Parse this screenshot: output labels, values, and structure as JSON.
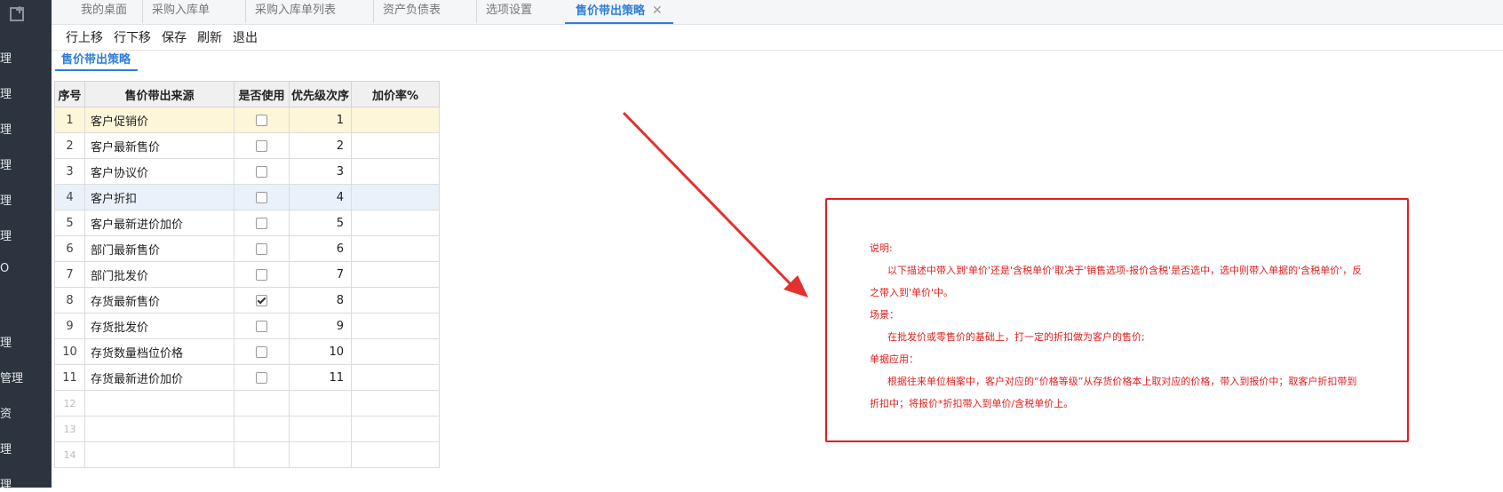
{
  "sidebar": {
    "items": [
      "理",
      "理",
      "理",
      "理",
      "理",
      "理",
      "O",
      "理",
      "管理",
      "资",
      "理",
      "理"
    ]
  },
  "tabs": [
    {
      "label": "我的桌面"
    },
    {
      "label": "采购入库单"
    },
    {
      "label": "采购入库单列表"
    },
    {
      "label": "资产负债表"
    },
    {
      "label": "选项设置"
    },
    {
      "label": "售价带出策略",
      "active": true,
      "close": "✕"
    }
  ],
  "toolbar": {
    "move_up": "行上移",
    "move_down": "行下移",
    "save": "保存",
    "refresh": "刷新",
    "exit": "退出"
  },
  "subtab": {
    "label": "售价带出策略"
  },
  "grid": {
    "headers": {
      "seq": "序号",
      "source": "售价带出来源",
      "enabled": "是否使用",
      "priority": "优先级次序",
      "markup": "加价率%"
    },
    "rows": [
      {
        "seq": "1",
        "source": "客户促销价",
        "checked": false,
        "priority": "1",
        "markup": ""
      },
      {
        "seq": "2",
        "source": "客户最新售价",
        "checked": false,
        "priority": "2",
        "markup": ""
      },
      {
        "seq": "3",
        "source": "客户协议价",
        "checked": false,
        "priority": "3",
        "markup": ""
      },
      {
        "seq": "4",
        "source": "客户折扣",
        "checked": false,
        "priority": "4",
        "markup": ""
      },
      {
        "seq": "5",
        "source": "客户最新进价加价",
        "checked": false,
        "priority": "5",
        "markup": ""
      },
      {
        "seq": "6",
        "source": "部门最新售价",
        "checked": false,
        "priority": "6",
        "markup": ""
      },
      {
        "seq": "7",
        "source": "部门批发价",
        "checked": false,
        "priority": "7",
        "markup": ""
      },
      {
        "seq": "8",
        "source": "存货最新售价",
        "checked": true,
        "priority": "8",
        "markup": ""
      },
      {
        "seq": "9",
        "source": "存货批发价",
        "checked": false,
        "priority": "9",
        "markup": ""
      },
      {
        "seq": "10",
        "source": "存货数量档位价格",
        "checked": false,
        "priority": "10",
        "markup": ""
      },
      {
        "seq": "11",
        "source": "存货最新进价加价",
        "checked": false,
        "priority": "11",
        "markup": ""
      }
    ],
    "empty_rows": [
      "12",
      "13",
      "14"
    ]
  },
  "note": {
    "title": "说明:",
    "desc_line1": "以下描述中带入到'单价'还是'含税单价'取决于'销售选项-报价含税'是否选中，选中则带入单据的'含税单价'，反",
    "desc_line2": "之带入到'单价'中。",
    "scene_title": "场景：",
    "scene_text": "在批发价或零售价的基础上，打一定的折扣做为客户的售价;",
    "usage_title": "单据应用：",
    "usage_line1": "根据往来单位档案中，客户对应的“价格等级”从存货价格本上取对应的价格，带入到报价中；取客户折扣带到",
    "usage_line2": "折扣中；将报价*折扣带入到单价/含税单价上。"
  },
  "colors": {
    "sidebar": "#2c3440",
    "accent": "#2f7ed8",
    "annotation_red": "#e02020",
    "row_highlight_yellow": "#fdf6d8",
    "row_highlight_blue": "#eaf1fb"
  }
}
